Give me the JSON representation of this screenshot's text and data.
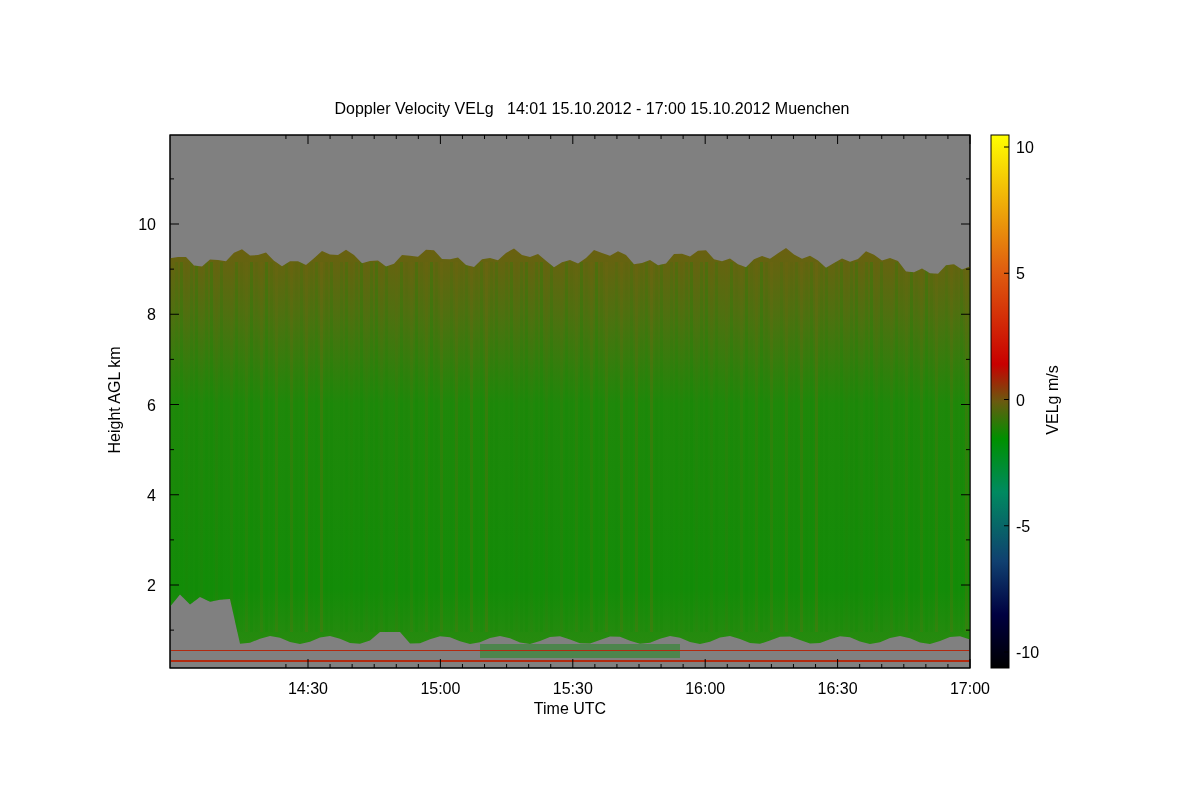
{
  "title": "Doppler Velocity VELg   14:01 15.10.2012 - 17:00 15.10.2012 Muenchen",
  "x_axis": {
    "label": "Time UTC",
    "ticks": [
      "14:30",
      "15:00",
      "15:30",
      "16:00",
      "16:30",
      "17:00"
    ]
  },
  "y_axis": {
    "label": "Height AGL km",
    "ticks": [
      "10",
      "8",
      "6",
      "4",
      "2"
    ]
  },
  "colorbar": {
    "label": "VELg m/s",
    "ticks": [
      "10",
      "5",
      "0",
      "-5",
      "-10"
    ]
  }
}
